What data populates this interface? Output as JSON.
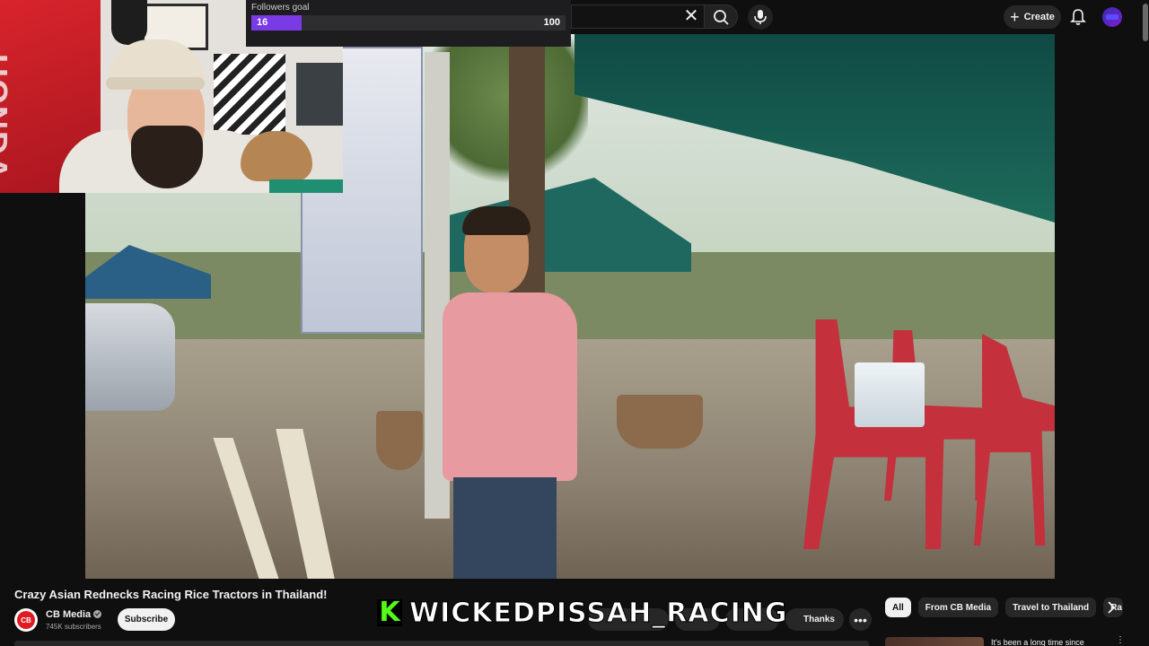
{
  "overlay": {
    "goal_title": "Followers goal",
    "goal_current": "16",
    "goal_target": "100",
    "goal_progress": 0.16
  },
  "webcam": {
    "flag_text": "HONDA"
  },
  "video": {
    "title": "Crazy Asian Rednecks Racing Rice Tractors in Thailand!"
  },
  "channel": {
    "name": "CB Media",
    "subscribers": "745K subscribers",
    "avatar_text": "CB"
  },
  "buttons": {
    "subscribe": "Subscribe",
    "thanks": "Thanks",
    "create": "Create"
  },
  "stream_overlay": {
    "logo_letter": "K",
    "handle": "WICKEDPISSAH_RACING"
  },
  "chips": [
    "All",
    "From CB Media",
    "Travel to Thailand",
    "Ra"
  ],
  "recommendation": {
    "title": "It's been a long time since"
  },
  "icons": {
    "clear": "close-icon",
    "search": "search-icon",
    "mic": "mic-icon",
    "create": "plus-icon",
    "bell": "bell-icon",
    "verified": "verified-icon",
    "more": "more-horizontal-icon",
    "next": "chevron-right-icon"
  },
  "colors": {
    "background": "#0f0f0f",
    "goal_fill": "#7a3ae6",
    "kick_green": "#53fc18",
    "channel_red": "#e21b23"
  }
}
